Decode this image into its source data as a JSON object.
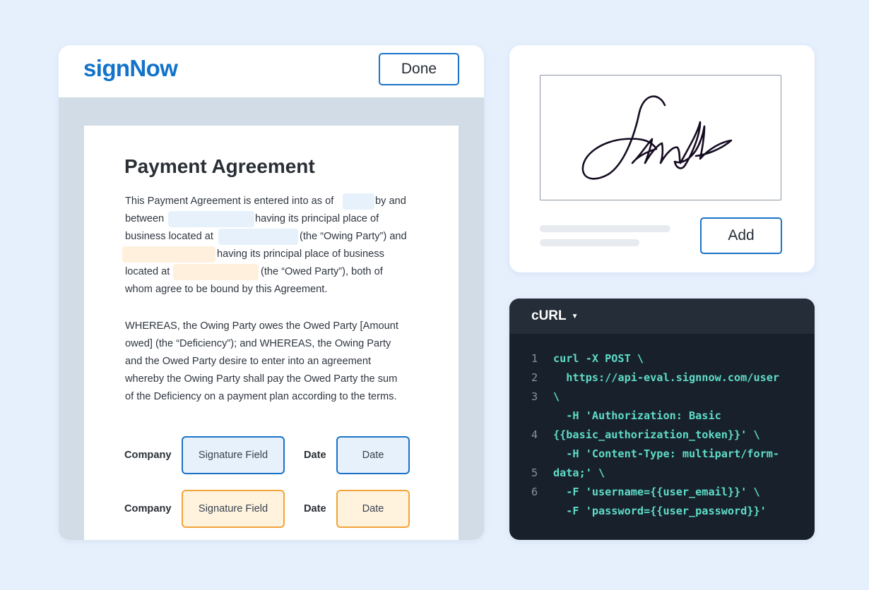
{
  "colors": {
    "brand": "#1273c9",
    "page_background": "#e6f0fd",
    "blue_field_fill": "#e6f1fb",
    "orange_field_fill": "#fff3de",
    "orange_field_border": "#f2a43a",
    "code_text": "#5fdcc8",
    "code_background": "#18212b"
  },
  "document_card": {
    "logo": "signNow",
    "done_label": "Done",
    "title": "Payment Agreement",
    "paragraph1": [
      [
        "This Payment Agreement is entered into as of",
        "by and"
      ],
      [
        "between",
        "having its principal place of"
      ],
      [
        "business located at",
        "(the “Owing Party”) and"
      ],
      [
        "having its principal place of business"
      ],
      [
        "located at",
        "(the “Owed Party”), both of"
      ],
      [
        "whom agree to be bound by this Agreement."
      ]
    ],
    "paragraph2": [
      "WHEREAS, the Owing Party owes the Owed Party [Amount",
      "owed] (the “Deficiency”); and WHEREAS, the Owing Party",
      "and the Owed Party desire to enter into an agreement",
      "whereby the Owing Party shall pay the Owed Party the sum",
      "of the Deficiency on a payment plan according to the terms."
    ],
    "signature_rows": [
      {
        "company_label": "Company",
        "signature_field": "Signature Field",
        "date_label": "Date",
        "date_field": "Date",
        "color": "blue"
      },
      {
        "company_label": "Company",
        "signature_field": "Signature Field",
        "date_label": "Date",
        "date_field": "Date",
        "color": "orange"
      }
    ]
  },
  "signature_card": {
    "add_label": "Add",
    "signature_icon": "handwritten-signature"
  },
  "code_card": {
    "language": "cURL",
    "caret_icon": "caret-down-icon",
    "line_numbers": [
      "1",
      "2",
      "3",
      "4",
      "5",
      "6"
    ],
    "lines": [
      "curl -X POST \\",
      "  https://api-eval.signnow.com/user",
      "\\",
      "  -H 'Authorization: Basic",
      "{{basic_authorization_token}}' \\",
      "  -H 'Content-Type: multipart/form-",
      "data;' \\",
      "  -F 'username={{user_email}}' \\",
      "  -F 'password={{user_password}}'"
    ]
  }
}
